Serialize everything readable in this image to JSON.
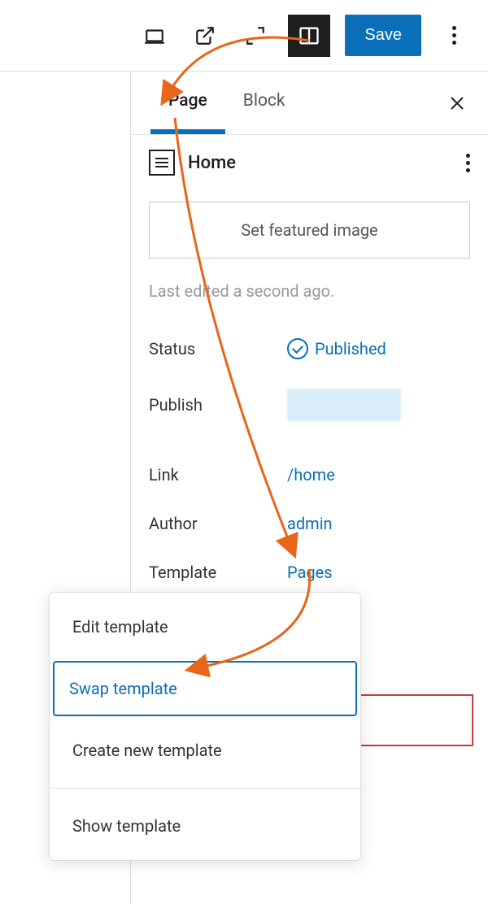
{
  "toolbar": {
    "save_label": "Save"
  },
  "panel": {
    "tabs": {
      "page": "Page",
      "block": "Block"
    },
    "page_title": "Home",
    "featured_image_label": "Set featured image",
    "last_edited": "Last edited a second ago.",
    "fields": {
      "status": {
        "label": "Status",
        "value": "Published"
      },
      "publish": {
        "label": "Publish"
      },
      "link": {
        "label": "Link",
        "value": "/home"
      },
      "author": {
        "label": "Author",
        "value": "admin"
      },
      "template": {
        "label": "Template",
        "value": "Pages"
      }
    }
  },
  "template_menu": {
    "edit": "Edit template",
    "swap": "Swap template",
    "create": "Create new template",
    "show": "Show template"
  }
}
